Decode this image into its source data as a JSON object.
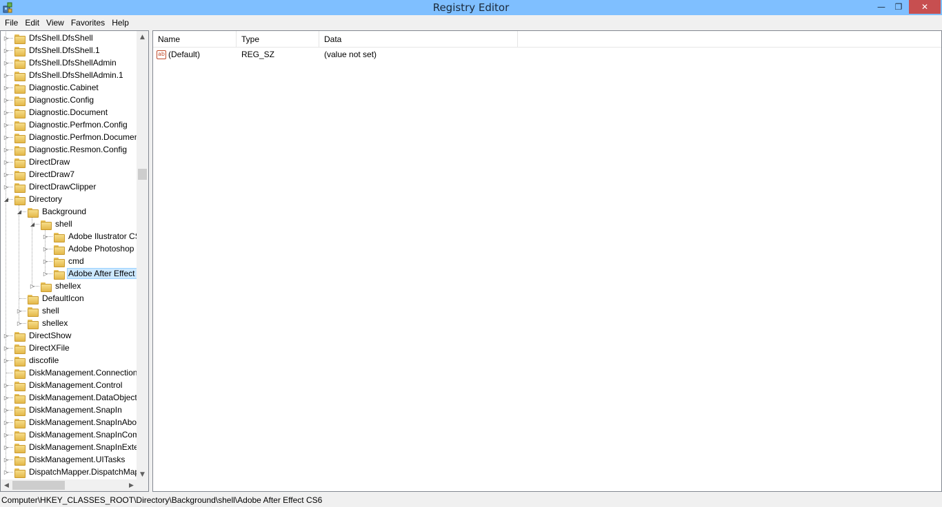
{
  "window": {
    "title": "Registry Editor",
    "icon": "registry-icon",
    "minimize_glyph": "—",
    "maximize_glyph": "❐",
    "close_glyph": "✕"
  },
  "menu": [
    {
      "label": "File"
    },
    {
      "label": "Edit"
    },
    {
      "label": "View"
    },
    {
      "label": "Favorites"
    },
    {
      "label": "Help"
    }
  ],
  "tree": [
    {
      "label": "DfsShell.DfsShell",
      "level": 0,
      "expander": "closed"
    },
    {
      "label": "DfsShell.DfsShell.1",
      "level": 0,
      "expander": "closed"
    },
    {
      "label": "DfsShell.DfsShellAdmin",
      "level": 0,
      "expander": "closed"
    },
    {
      "label": "DfsShell.DfsShellAdmin.1",
      "level": 0,
      "expander": "closed"
    },
    {
      "label": "Diagnostic.Cabinet",
      "level": 0,
      "expander": "closed"
    },
    {
      "label": "Diagnostic.Config",
      "level": 0,
      "expander": "closed"
    },
    {
      "label": "Diagnostic.Document",
      "level": 0,
      "expander": "closed"
    },
    {
      "label": "Diagnostic.Perfmon.Config",
      "level": 0,
      "expander": "closed"
    },
    {
      "label": "Diagnostic.Perfmon.Documen",
      "level": 0,
      "expander": "closed"
    },
    {
      "label": "Diagnostic.Resmon.Config",
      "level": 0,
      "expander": "closed"
    },
    {
      "label": "DirectDraw",
      "level": 0,
      "expander": "closed"
    },
    {
      "label": "DirectDraw7",
      "level": 0,
      "expander": "closed"
    },
    {
      "label": "DirectDrawClipper",
      "level": 0,
      "expander": "closed"
    },
    {
      "label": "Directory",
      "level": 0,
      "expander": "open"
    },
    {
      "label": "Background",
      "level": 1,
      "expander": "open"
    },
    {
      "label": "shell",
      "level": 2,
      "expander": "open"
    },
    {
      "label": "Adobe Ilustrator CS",
      "level": 3,
      "expander": "closed"
    },
    {
      "label": "Adobe Photoshop (",
      "level": 3,
      "expander": "closed"
    },
    {
      "label": "cmd",
      "level": 3,
      "expander": "closed"
    },
    {
      "label": "Adobe After Effect (",
      "level": 3,
      "expander": "closed",
      "selected": true
    },
    {
      "label": "shellex",
      "level": 2,
      "expander": "closed"
    },
    {
      "label": "DefaultIcon",
      "level": 1,
      "expander": "none"
    },
    {
      "label": "shell",
      "level": 1,
      "expander": "closed"
    },
    {
      "label": "shellex",
      "level": 1,
      "expander": "closed"
    },
    {
      "label": "DirectShow",
      "level": 0,
      "expander": "closed"
    },
    {
      "label": "DirectXFile",
      "level": 0,
      "expander": "closed"
    },
    {
      "label": "discofile",
      "level": 0,
      "expander": "closed"
    },
    {
      "label": "DiskManagement.Connection",
      "level": 0,
      "expander": "none"
    },
    {
      "label": "DiskManagement.Control",
      "level": 0,
      "expander": "closed"
    },
    {
      "label": "DiskManagement.DataObject",
      "level": 0,
      "expander": "closed"
    },
    {
      "label": "DiskManagement.SnapIn",
      "level": 0,
      "expander": "closed"
    },
    {
      "label": "DiskManagement.SnapInAbou",
      "level": 0,
      "expander": "closed"
    },
    {
      "label": "DiskManagement.SnapInCom",
      "level": 0,
      "expander": "closed"
    },
    {
      "label": "DiskManagement.SnapInExten",
      "level": 0,
      "expander": "closed"
    },
    {
      "label": "DiskManagement.UITasks",
      "level": 0,
      "expander": "closed"
    },
    {
      "label": "DispatchMapper.DispatchMap",
      "level": 0,
      "expander": "closed"
    }
  ],
  "list": {
    "columns": {
      "name": "Name",
      "type": "Type",
      "data": "Data"
    },
    "rows": [
      {
        "icon": "string-value-icon",
        "icon_text": "ab",
        "name": "(Default)",
        "type": "REG_SZ",
        "data": "(value not set)"
      }
    ]
  },
  "status": {
    "path": "Computer\\HKEY_CLASSES_ROOT\\Directory\\Background\\shell\\Adobe After Effect CS6"
  },
  "scroll": {
    "up_glyph": "▲",
    "down_glyph": "▼",
    "left_glyph": "◀",
    "right_glyph": "▶"
  },
  "colors": {
    "titlebar": "#7fbfff",
    "close_button": "#c74f50",
    "selection": "#cce8ff"
  }
}
